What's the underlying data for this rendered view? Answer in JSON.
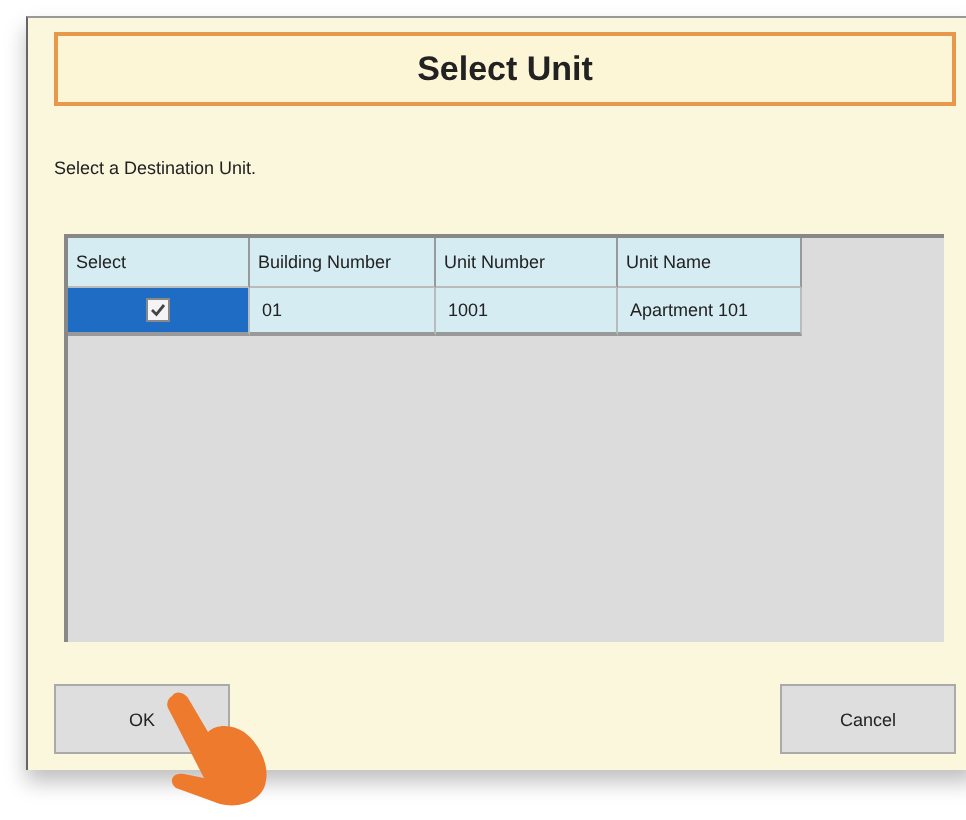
{
  "dialog": {
    "title": "Select Unit",
    "instruction": "Select a Destination Unit.",
    "table": {
      "select_column": "Select",
      "columns": [
        "Building Number",
        "Unit Number",
        "Unit Name"
      ],
      "rows": [
        {
          "selected": true,
          "checked": true,
          "cells": [
            "01",
            "1001",
            "Apartment 101"
          ]
        }
      ]
    },
    "buttons": [
      "OK",
      "Cancel"
    ]
  }
}
